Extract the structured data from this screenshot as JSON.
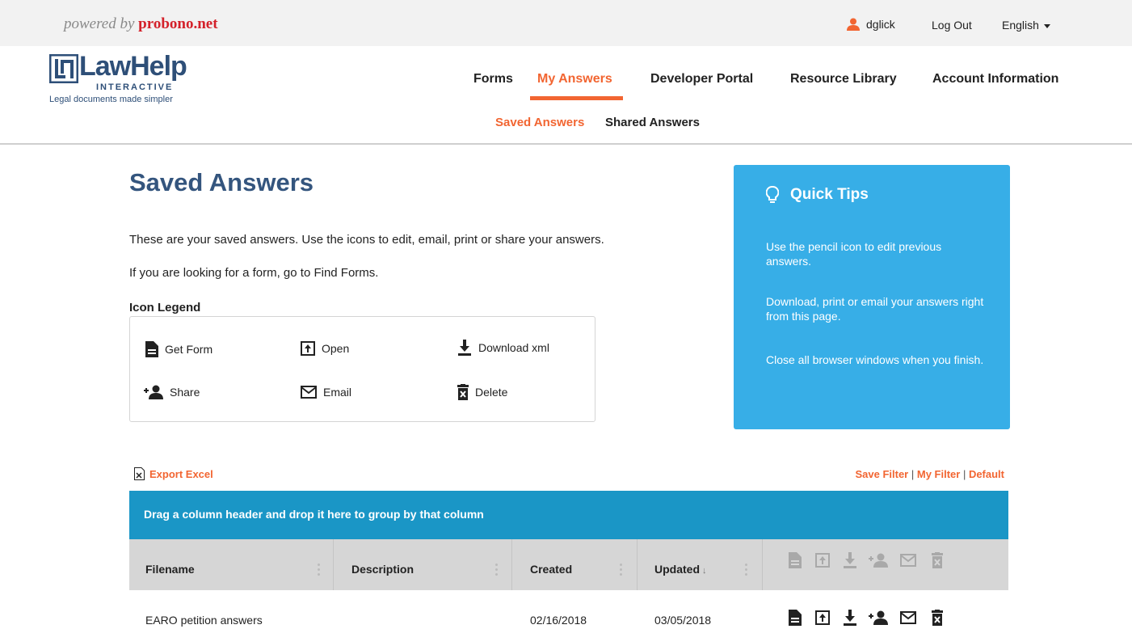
{
  "topbar": {
    "powered_prefix": "powered by ",
    "powered_brand": "probono.net",
    "username": "dglick",
    "logout": "Log Out",
    "language": "English"
  },
  "logo": {
    "word_law": "Law",
    "word_help": "Help",
    "sub": "INTERACTIVE",
    "tagline": "Legal documents made simpler"
  },
  "nav": {
    "items": [
      {
        "label": "Forms",
        "active": false
      },
      {
        "label": "My Answers",
        "active": true
      },
      {
        "label": "Developer Portal",
        "active": false
      },
      {
        "label": "Resource Library",
        "active": false
      },
      {
        "label": "Account Information",
        "active": false
      }
    ],
    "subnav": [
      {
        "label": "Saved Answers",
        "active": true
      },
      {
        "label": "Shared Answers",
        "active": false
      }
    ]
  },
  "main": {
    "title": "Saved Answers",
    "intro_1": "These are your saved answers. Use the icons to edit, email, print or share your answers.",
    "intro_2": "If you are looking for a form, go to Find Forms.",
    "legend_title": "Icon Legend",
    "legend": [
      {
        "label": "Get Form",
        "icon": "document-icon"
      },
      {
        "label": "Open",
        "icon": "open-icon"
      },
      {
        "label": "Download xml",
        "icon": "download-icon"
      },
      {
        "label": "Share",
        "icon": "add-user-icon"
      },
      {
        "label": "Email",
        "icon": "envelope-icon"
      },
      {
        "label": "Delete",
        "icon": "trash-icon"
      }
    ]
  },
  "tips": {
    "title": "Quick Tips",
    "items": [
      "Use the pencil icon to edit previous answers.",
      "Download, print or email your answers right from this page.",
      "Close all browser windows when you finish."
    ]
  },
  "grid": {
    "export_label": "Export Excel",
    "save_filter": "Save Filter",
    "my_filter": "My Filter",
    "default_filter": "Default",
    "group_hint": "Drag a column header and drop it here to group by that column",
    "columns": [
      "Filename",
      "Description",
      "Created",
      "Updated"
    ],
    "sort_indicator": "↓",
    "rows": [
      {
        "filename": "EARO petition answers",
        "description": "",
        "created": "02/16/2018",
        "updated": "03/05/2018"
      }
    ]
  },
  "colors": {
    "accent": "#f26531",
    "brand_blue": "#34557e",
    "tips_bg": "#37aee7",
    "group_bar": "#1a96c6"
  }
}
